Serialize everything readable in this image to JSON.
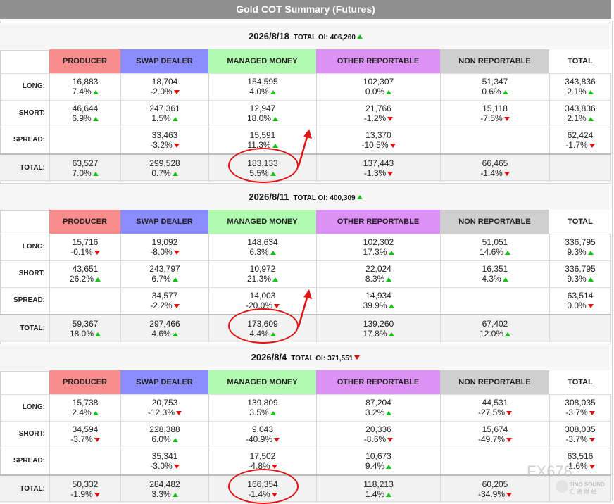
{
  "title": "Gold COT Summary (Futures)",
  "colors": {
    "producer": "#f98c8c",
    "swap_dealer": "#8a8cff",
    "managed_money": "#b0fbb0",
    "other_reportable": "#dd91f7",
    "non_reportable": "#cfcfcf",
    "total": "#ffffff",
    "up": "#19c219",
    "down": "#dd1111",
    "highlight": "#e01414"
  },
  "headers": [
    "PRODUCER",
    "SWAP DEALER",
    "MANAGED MONEY",
    "OTHER REPORTABLE",
    "NON REPORTABLE",
    "TOTAL"
  ],
  "row_labels": [
    "LONG:",
    "SHORT:",
    "SPREAD:",
    "TOTAL:"
  ],
  "sections": [
    {
      "date": "2026/8/18",
      "oi_label": "TOTAL OI:",
      "oi_value": "406,260",
      "oi_dir": "up",
      "rows": [
        [
          [
            "16,883",
            "7.4%",
            "up"
          ],
          [
            "18,704",
            "-2.0%",
            "down"
          ],
          [
            "154,595",
            "4.0%",
            "up"
          ],
          [
            "102,307",
            "0.0%",
            "up"
          ],
          [
            "51,347",
            "0.6%",
            "up"
          ],
          [
            "343,836",
            "2.1%",
            "up"
          ]
        ],
        [
          [
            "46,644",
            "6.9%",
            "up"
          ],
          [
            "247,361",
            "1.5%",
            "up"
          ],
          [
            "12,947",
            "18.0%",
            "up"
          ],
          [
            "21,766",
            "-1.2%",
            "down"
          ],
          [
            "15,118",
            "-7.5%",
            "down"
          ],
          [
            "343,836",
            "2.1%",
            "up"
          ]
        ],
        [
          [
            "",
            "",
            ""
          ],
          [
            "33,463",
            "-3.2%",
            "down"
          ],
          [
            "15,591",
            "11.3%",
            "up"
          ],
          [
            "13,370",
            "-10.5%",
            "down"
          ],
          [
            "",
            "",
            ""
          ],
          [
            "62,424",
            "-1.7%",
            "down"
          ]
        ],
        [
          [
            "63,527",
            "7.0%",
            "up"
          ],
          [
            "299,528",
            "0.7%",
            "up"
          ],
          [
            "183,133",
            "5.5%",
            "up"
          ],
          [
            "137,443",
            "-1.3%",
            "down"
          ],
          [
            "66,465",
            "-1.4%",
            "down"
          ],
          [
            "",
            "",
            ""
          ]
        ]
      ]
    },
    {
      "date": "2026/8/11",
      "oi_label": "TOTAL OI:",
      "oi_value": "400,309",
      "oi_dir": "up",
      "rows": [
        [
          [
            "15,716",
            "-0.1%",
            "down"
          ],
          [
            "19,092",
            "-8.0%",
            "down"
          ],
          [
            "148,634",
            "6.3%",
            "up"
          ],
          [
            "102,302",
            "17.3%",
            "up"
          ],
          [
            "51,051",
            "14.6%",
            "up"
          ],
          [
            "336,795",
            "9.3%",
            "up"
          ]
        ],
        [
          [
            "43,651",
            "26.2%",
            "up"
          ],
          [
            "243,797",
            "6.7%",
            "up"
          ],
          [
            "10,972",
            "21.3%",
            "up"
          ],
          [
            "22,024",
            "8.3%",
            "up"
          ],
          [
            "16,351",
            "4.3%",
            "up"
          ],
          [
            "336,795",
            "9.3%",
            "up"
          ]
        ],
        [
          [
            "",
            "",
            ""
          ],
          [
            "34,577",
            "-2.2%",
            "down"
          ],
          [
            "14,003",
            "-20.0%",
            "down"
          ],
          [
            "14,934",
            "39.9%",
            "up"
          ],
          [
            "",
            "",
            ""
          ],
          [
            "63,514",
            "0.0%",
            "down"
          ]
        ],
        [
          [
            "59,367",
            "18.0%",
            "up"
          ],
          [
            "297,466",
            "4.6%",
            "up"
          ],
          [
            "173,609",
            "4.4%",
            "up"
          ],
          [
            "139,260",
            "17.8%",
            "up"
          ],
          [
            "67,402",
            "12.0%",
            "up"
          ],
          [
            "",
            "",
            ""
          ]
        ]
      ]
    },
    {
      "date": "2026/8/4",
      "oi_label": "TOTAL OI:",
      "oi_value": "371,551",
      "oi_dir": "down",
      "rows": [
        [
          [
            "15,738",
            "2.4%",
            "up"
          ],
          [
            "20,753",
            "-12.3%",
            "down"
          ],
          [
            "139,809",
            "3.5%",
            "up"
          ],
          [
            "87,204",
            "3.2%",
            "up"
          ],
          [
            "44,531",
            "-27.5%",
            "down"
          ],
          [
            "308,035",
            "-3.7%",
            "down"
          ]
        ],
        [
          [
            "34,594",
            "-3.7%",
            "down"
          ],
          [
            "228,388",
            "6.0%",
            "up"
          ],
          [
            "9,043",
            "-40.9%",
            "down"
          ],
          [
            "20,336",
            "-8.6%",
            "down"
          ],
          [
            "15,674",
            "-49.7%",
            "down"
          ],
          [
            "308,035",
            "-3.7%",
            "down"
          ]
        ],
        [
          [
            "",
            "",
            ""
          ],
          [
            "35,341",
            "-3.0%",
            "down"
          ],
          [
            "17,502",
            "-4.8%",
            "down"
          ],
          [
            "10,673",
            "9.4%",
            "up"
          ],
          [
            "",
            "",
            ""
          ],
          [
            "63,516",
            "-1.6%",
            "down"
          ]
        ],
        [
          [
            "50,332",
            "-1.9%",
            "down"
          ],
          [
            "284,482",
            "3.3%",
            "up"
          ],
          [
            "166,354",
            "-1.4%",
            "down"
          ],
          [
            "118,213",
            "1.4%",
            "up"
          ],
          [
            "60,205",
            "-34.9%",
            "down"
          ],
          [
            "",
            "",
            ""
          ]
        ]
      ]
    }
  ],
  "watermark": {
    "brand": "FX678",
    "sub": "SINO SOUND",
    "cn": "汇 通 财 经"
  }
}
